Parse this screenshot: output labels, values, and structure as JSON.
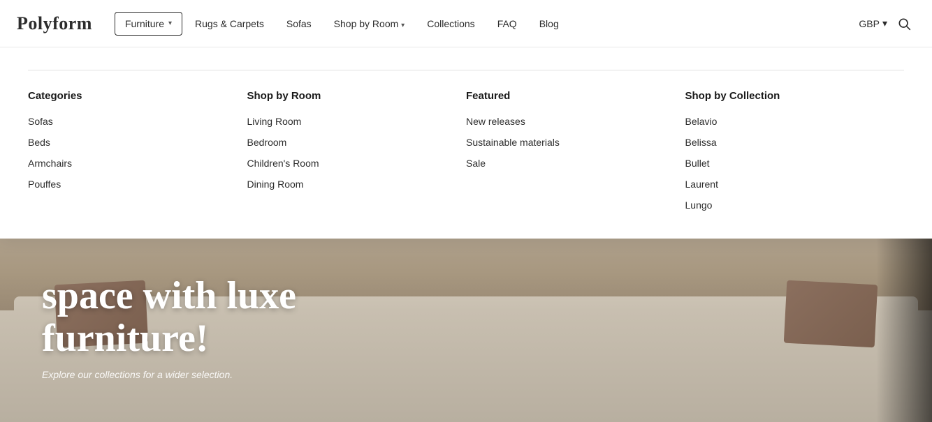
{
  "brand": {
    "name": "Polyform"
  },
  "navbar": {
    "items": [
      {
        "label": "Furniture",
        "active": true,
        "has_chevron": true
      },
      {
        "label": "Rugs & Carpets",
        "active": false
      },
      {
        "label": "Sofas",
        "active": false
      },
      {
        "label": "Shop by Room",
        "active": false,
        "has_chevron": true
      },
      {
        "label": "Collections",
        "active": false
      },
      {
        "label": "FAQ",
        "active": false
      },
      {
        "label": "Blog",
        "active": false
      }
    ],
    "currency": "GBP",
    "currency_chevron": "▾"
  },
  "dropdown": {
    "categories_header": "Categories",
    "categories_items": [
      "Sofas",
      "Beds",
      "Armchairs",
      "Pouffes"
    ],
    "shop_by_room_header": "Shop by Room",
    "shop_by_room_items": [
      "Living Room",
      "Bedroom",
      "Children's Room",
      "Dining Room"
    ],
    "featured_header": "Featured",
    "featured_items": [
      "New releases",
      "Sustainable materials",
      "Sale"
    ],
    "collections_header": "Shop by Collection",
    "collections_items": [
      "Belavio",
      "Belissa",
      "Bullet",
      "Laurent",
      "Lungo"
    ]
  },
  "hero": {
    "headline": "space with luxe furniture!",
    "subtext": "Explore our collections for a wider selection."
  }
}
